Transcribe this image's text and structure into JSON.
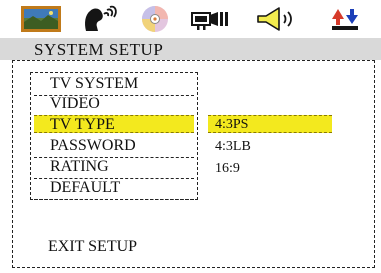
{
  "toolbar": {
    "icons": [
      {
        "name": "picture-icon",
        "active": true
      },
      {
        "name": "speaker-person-icon",
        "active": false
      },
      {
        "name": "disc-icon",
        "active": false
      },
      {
        "name": "projector-icon",
        "active": false
      },
      {
        "name": "speaker-volume-icon",
        "active": false
      },
      {
        "name": "up-down-arrows-icon",
        "active": false
      }
    ]
  },
  "header": {
    "title": "SYSTEM SETUP"
  },
  "menu": {
    "items": [
      {
        "label": "TV SYSTEM",
        "selected": false
      },
      {
        "label": "VIDEO",
        "selected": false
      },
      {
        "label": "TV TYPE",
        "selected": true
      },
      {
        "label": "PASSWORD",
        "selected": false
      },
      {
        "label": "RATING",
        "selected": false
      },
      {
        "label": "DEFAULT",
        "selected": false
      }
    ]
  },
  "options": {
    "items": [
      {
        "label": "4:3PS",
        "selected": true
      },
      {
        "label": "4:3LB",
        "selected": false
      },
      {
        "label": "16:9",
        "selected": false
      }
    ]
  },
  "footer": {
    "exit_label": "EXIT SETUP"
  },
  "colors": {
    "highlight": "#f3e91e",
    "header_bg": "#d9d9d9",
    "brown": "#8b5a2b",
    "orange": "#e8880f",
    "red": "#d63a2a",
    "blue": "#1c3fb8"
  }
}
